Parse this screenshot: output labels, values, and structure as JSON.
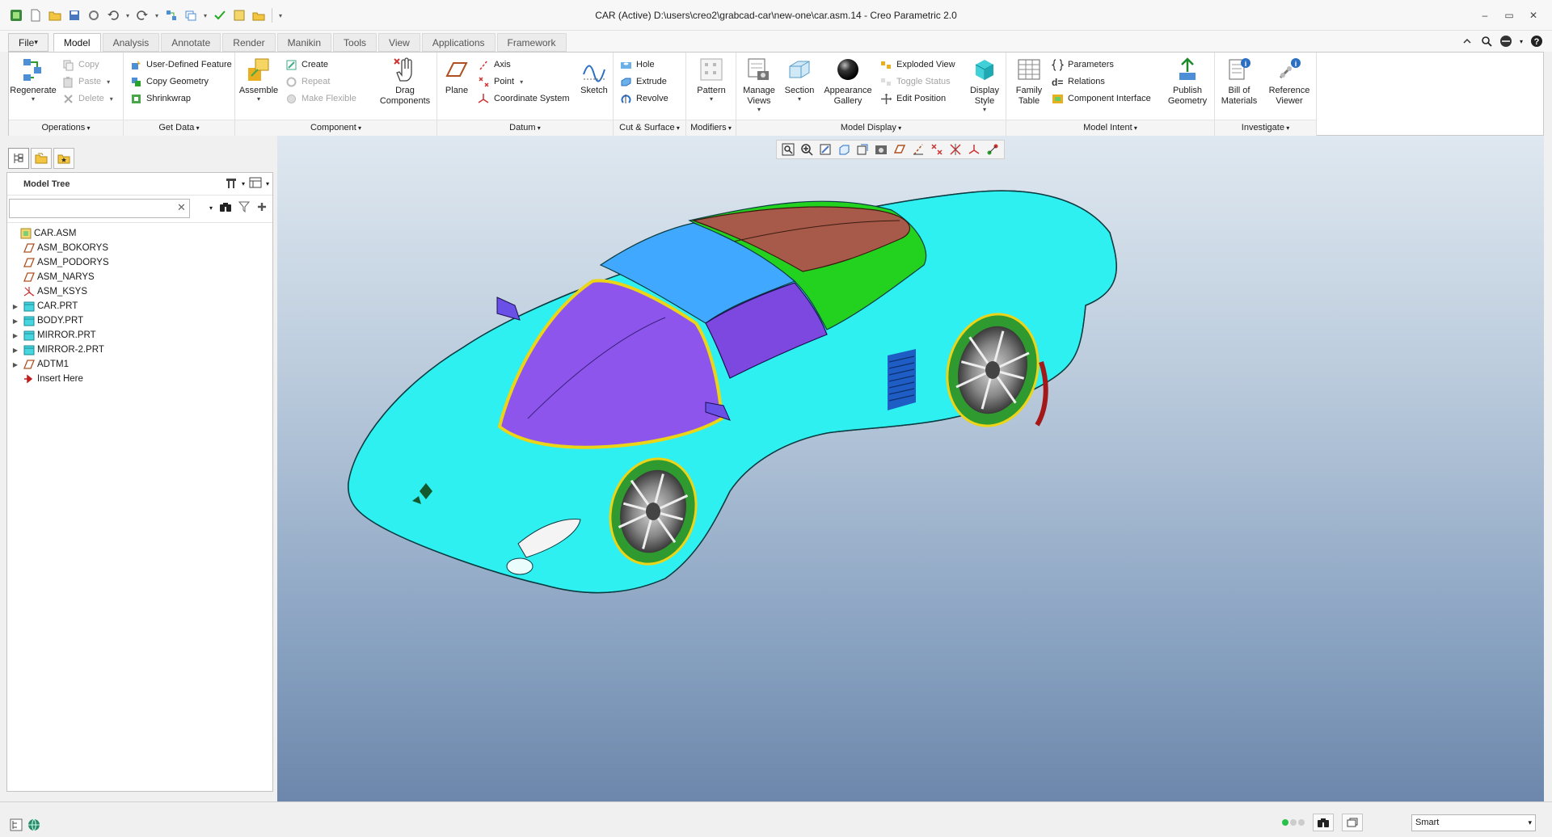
{
  "window": {
    "title": "CAR (Active) D:\\users\\creo2\\grabcad-car\\new-one\\car.asm.14 - Creo Parametric 2.0"
  },
  "tabs": [
    "File",
    "Model",
    "Analysis",
    "Annotate",
    "Render",
    "Manikin",
    "Tools",
    "View",
    "Applications",
    "Framework"
  ],
  "active_tab": "Model",
  "ribbon": {
    "operations": {
      "label": "Operations",
      "regenerate": "Regenerate",
      "copy": "Copy",
      "paste": "Paste",
      "delete": "Delete"
    },
    "get_data": {
      "label": "Get Data",
      "user_defined_feature": "User-Defined Feature",
      "copy_geometry": "Copy Geometry",
      "shrinkwrap": "Shrinkwrap"
    },
    "component": {
      "label": "Component",
      "assemble": "Assemble",
      "create": "Create",
      "repeat": "Repeat",
      "make_flexible": "Make Flexible",
      "drag_components": "Drag\nComponents"
    },
    "datum": {
      "label": "Datum",
      "plane": "Plane",
      "axis": "Axis",
      "point": "Point",
      "coordinate_system": "Coordinate System",
      "sketch": "Sketch"
    },
    "cut_surface": {
      "label": "Cut & Surface",
      "hole": "Hole",
      "extrude": "Extrude",
      "revolve": "Revolve"
    },
    "modifiers": {
      "label": "Modifiers",
      "pattern": "Pattern"
    },
    "model_display": {
      "label": "Model Display",
      "manage_views": "Manage\nViews",
      "section": "Section",
      "appearance_gallery": "Appearance\nGallery",
      "exploded_view": "Exploded View",
      "toggle_status": "Toggle Status",
      "edit_position": "Edit Position",
      "display_style": "Display\nStyle"
    },
    "model_intent": {
      "label": "Model Intent",
      "family_table": "Family\nTable",
      "parameters": "Parameters",
      "relations": "Relations",
      "component_interface": "Component Interface",
      "publish_geometry": "Publish\nGeometry"
    },
    "investigate": {
      "label": "Investigate",
      "bill_of_materials": "Bill of\nMaterials",
      "reference_viewer": "Reference\nViewer"
    }
  },
  "model_tree": {
    "title": "Model Tree",
    "search_placeholder": "",
    "items": [
      {
        "label": "CAR.ASM",
        "type": "asm",
        "expand": false
      },
      {
        "label": "ASM_BOKORYS",
        "type": "plane",
        "expand": false
      },
      {
        "label": "ASM_PODORYS",
        "type": "plane",
        "expand": false
      },
      {
        "label": "ASM_NARYS",
        "type": "plane",
        "expand": false
      },
      {
        "label": "ASM_KSYS",
        "type": "csys",
        "expand": false
      },
      {
        "label": "CAR.PRT",
        "type": "part",
        "expand": true
      },
      {
        "label": "BODY.PRT",
        "type": "part",
        "expand": true
      },
      {
        "label": "MIRROR.PRT",
        "type": "part",
        "expand": true
      },
      {
        "label": "MIRROR-2.PRT",
        "type": "part",
        "expand": true
      },
      {
        "label": "ADTM1",
        "type": "plane",
        "expand": true
      },
      {
        "label": "Insert Here",
        "type": "insert",
        "expand": false
      }
    ]
  },
  "status": {
    "filter": "Smart"
  },
  "colors": {
    "body": "#2ff0f0",
    "roof": "#41a8ff",
    "glass": "#8d55ec",
    "rear": "#23d21e",
    "spoiler": "#a85a4a",
    "tire": "#2f9a2f",
    "accent": "#1e7ac8"
  }
}
